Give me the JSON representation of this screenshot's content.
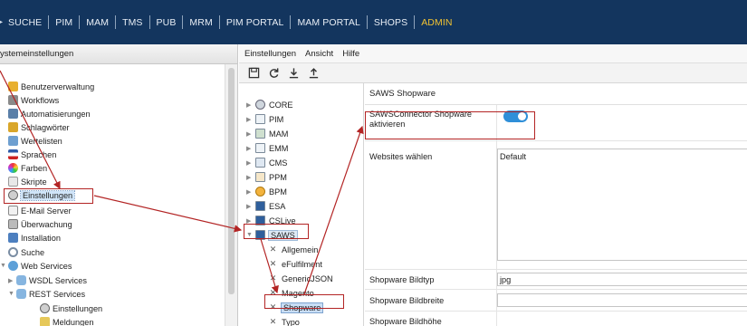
{
  "topnav": {
    "items": [
      "SUCHE",
      "PIM",
      "MAM",
      "TMS",
      "PUB",
      "MRM",
      "PIM PORTAL",
      "MAM PORTAL",
      "SHOPS",
      "ADMIN"
    ]
  },
  "left": {
    "title": "ystemeinstellungen",
    "items": [
      {
        "label": "Benutzerverwaltung",
        "icon": "user-icon"
      },
      {
        "label": "Workflows",
        "icon": "workflow-icon"
      },
      {
        "label": "Automatisierungen",
        "icon": "calendar-icon"
      },
      {
        "label": "Schlagwörter",
        "icon": "tag-icon"
      },
      {
        "label": "Wertelisten",
        "icon": "list-icon"
      },
      {
        "label": "Sprachen",
        "icon": "flag-icon"
      },
      {
        "label": "Farben",
        "icon": "color-icon"
      },
      {
        "label": "Skripte",
        "icon": "script-icon"
      },
      {
        "label": "Einstellungen",
        "icon": "settings-icon"
      },
      {
        "label": "E-Mail Server",
        "icon": "mail-icon"
      },
      {
        "label": "Überwachung",
        "icon": "monitor-icon"
      },
      {
        "label": "Installation",
        "icon": "install-icon"
      },
      {
        "label": "Suche",
        "icon": "search-icon"
      },
      {
        "label": "Web Services",
        "icon": "globe-icon"
      },
      {
        "label": "WSDL Services",
        "icon": "service-icon"
      },
      {
        "label": "REST Services",
        "icon": "service-icon"
      },
      {
        "label": "Einstellungen",
        "icon": "settings-icon"
      },
      {
        "label": "Meldungen",
        "icon": "message-icon"
      }
    ]
  },
  "menubar": {
    "items": [
      "Einstellungen",
      "Ansicht",
      "Hilfe"
    ]
  },
  "toolbar": {
    "icons": [
      "save-icon",
      "refresh-icon",
      "download-icon",
      "upload-icon"
    ]
  },
  "tree": {
    "items": [
      "CORE",
      "PIM",
      "MAM",
      "EMM",
      "CMS",
      "PPM",
      "BPM",
      "ESA",
      "CSLive",
      "SAWS"
    ],
    "children": [
      "Allgemein",
      "eFulfilment",
      "GenericJSON",
      "Magento",
      "Shopware",
      "Typo"
    ]
  },
  "form": {
    "title": "SAWS Shopware",
    "activate_label": "SAWSConnector Shopware aktivieren",
    "activate_state": true,
    "websites_label": "Websites wählen",
    "websites_value": "Default",
    "bildtyp_label": "Shopware Bildtyp",
    "bildtyp_value": "jpg",
    "bildbreite_label": "Shopware Bildbreite",
    "bildbreite_value": "",
    "bildhoehe_label": "Shopware Bildhöhe"
  },
  "colors": {
    "nav_bg": "#13355e",
    "admin_accent": "#f1c232",
    "annotation": "#b32424",
    "toggle_on": "#2f8fd8"
  }
}
